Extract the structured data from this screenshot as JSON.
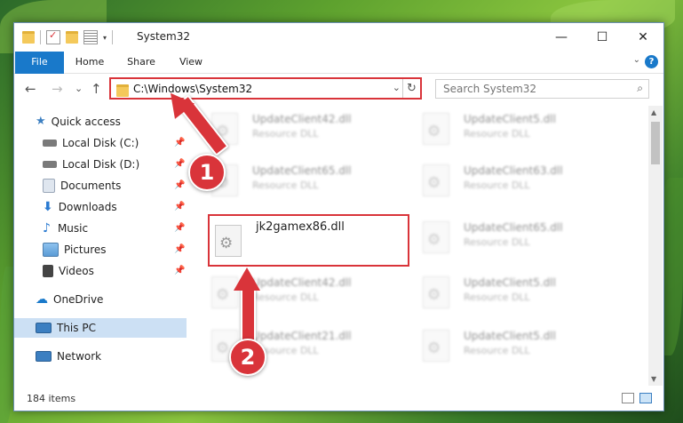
{
  "window": {
    "title": "System32",
    "minimize": "—",
    "maximize": "☐",
    "close": "✕"
  },
  "ribbon": {
    "tabs": [
      "File",
      "Home",
      "Share",
      "View"
    ],
    "help": "?",
    "expand": "⌄"
  },
  "nav": {
    "back": "←",
    "forward": "→",
    "recent": "⌄",
    "up": "↑"
  },
  "address": {
    "path": "C:\\Windows\\System32",
    "dropdown": "⌄",
    "refresh": "↻"
  },
  "search": {
    "placeholder": "Search System32",
    "icon": "⌕"
  },
  "sidebar": {
    "items": [
      {
        "label": "Quick access",
        "icon": "star-icon",
        "pinned": false,
        "color": "#3c7fc1"
      },
      {
        "label": "Local Disk (C:)",
        "icon": "drive-icon",
        "pinned": true,
        "color": "#7a7a7a"
      },
      {
        "label": "Local Disk (D:)",
        "icon": "drive-icon",
        "pinned": true,
        "color": "#7a7a7a"
      },
      {
        "label": "Documents",
        "icon": "documents-icon",
        "pinned": true,
        "color": "#9aa7b8"
      },
      {
        "label": "Downloads",
        "icon": "download-icon",
        "pinned": true,
        "color": "#2a7ad1"
      },
      {
        "label": "Music",
        "icon": "music-icon",
        "pinned": true,
        "color": "#2a7ad1"
      },
      {
        "label": "Pictures",
        "icon": "pictures-icon",
        "pinned": true,
        "color": "#5a9bd5"
      },
      {
        "label": "Videos",
        "icon": "videos-icon",
        "pinned": true,
        "color": "#444"
      },
      {
        "label": "OneDrive",
        "icon": "cloud-icon",
        "pinned": false,
        "color": "#1979ca"
      },
      {
        "label": "This PC",
        "icon": "computer-icon",
        "pinned": false,
        "color": "#3c7fc1"
      },
      {
        "label": "Network",
        "icon": "network-icon",
        "pinned": false,
        "color": "#3c7fc1"
      }
    ],
    "pin_glyph": "📌"
  },
  "files": [
    {
      "name": "UpdateClient42.dll",
      "type": "Resource DLL"
    },
    {
      "name": "UpdateClient5.dll",
      "type": "Resource DLL"
    },
    {
      "name": "UpdateClient65.dll",
      "type": "Resource DLL"
    },
    {
      "name": "UpdateClient63.dll",
      "type": "Resource DLL"
    },
    {
      "name": "jk2gamex86.dll",
      "type": ""
    },
    {
      "name": "UpdateClient65.dll",
      "type": "Resource DLL"
    },
    {
      "name": "UpdateClient42.dll",
      "type": "Resource DLL"
    },
    {
      "name": "UpdateClient5.dll",
      "type": "Resource DLL"
    },
    {
      "name": "UpdateClient21.dll",
      "type": "Resource DLL"
    },
    {
      "name": "UpdateClient5.dll",
      "type": "Resource DLL"
    }
  ],
  "status": {
    "item_count": "184 items"
  },
  "annotations": {
    "step1": "1",
    "step2": "2",
    "color": "#d9343a"
  }
}
